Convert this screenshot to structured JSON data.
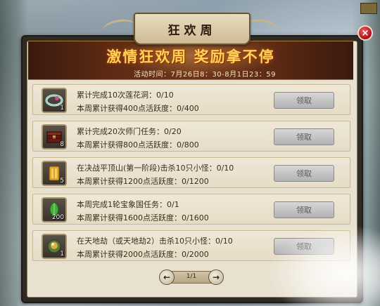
{
  "window": {
    "title": "狂欢周",
    "close_label": "×"
  },
  "banner": {
    "headline": "激情狂欢周 奖励拿不停",
    "time": "活动时间：7月26日8：30-8月1日23：59"
  },
  "tasks": [
    {
      "line1": "累计完成10次莲花洞：0/10",
      "line2": "本周累计获得400点活跃度：0/400",
      "count": "1",
      "icon": "jade-ring-icon",
      "claim_label": "领取"
    },
    {
      "line1": "累计完成20次师门任务：0/20",
      "line2": "本周累计获得800点活跃度：0/800",
      "count": "8",
      "icon": "treasure-chest-icon",
      "claim_label": "领取"
    },
    {
      "line1": "在决战平顶山(第一阶段)击杀10只小怪：0/10",
      "line2": "本周累计获得1200点活跃度：0/1200",
      "count": "5",
      "icon": "gold-ingot-icon",
      "claim_label": "领取"
    },
    {
      "line1": "本周完成1轮宝象国任务：0/1",
      "line2": "本周累计获得1600点活跃度：0/1600",
      "count": "200",
      "icon": "green-leaf-icon",
      "claim_label": "领取"
    },
    {
      "line1": "在天地劫（或天地劫2）击杀10只小怪：0/10",
      "line2": "本周累计获得2000点活跃度：0/2000",
      "count": "1",
      "icon": "spirit-orb-icon",
      "claim_label": "领取"
    }
  ],
  "pager": {
    "text": "1/1"
  }
}
